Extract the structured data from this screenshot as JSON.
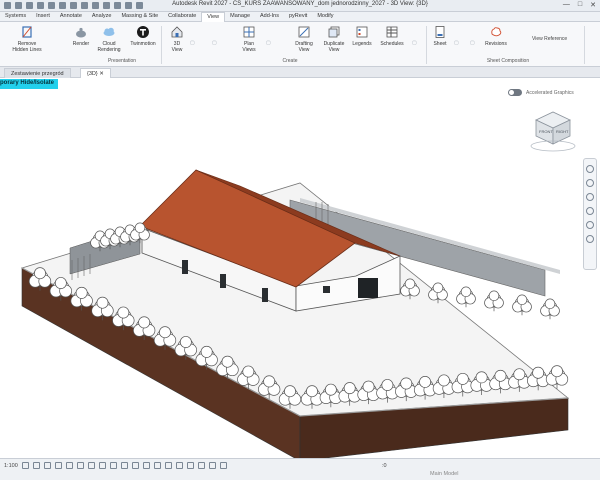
{
  "titlebar": {
    "title": "Autodesk Revit 2027 - CS_KURS ZAAWANSOWANY_dom jednorodzinny_2027 - 3D View: {3D}",
    "quick_access_icons": [
      "open-icon",
      "save-icon",
      "undo-icon",
      "redo-icon",
      "print-icon",
      "measure-icon",
      "tag-icon",
      "text-icon",
      "3d-view-icon",
      "section-icon",
      "thin-lines-icon",
      "close-hidden-icon",
      "switch-windows-icon"
    ]
  },
  "ribbon_tabs": [
    {
      "label": "Systems",
      "active": false
    },
    {
      "label": "Insert",
      "active": false
    },
    {
      "label": "Annotate",
      "active": false
    },
    {
      "label": "Analyze",
      "active": false
    },
    {
      "label": "Massing & Site",
      "active": false
    },
    {
      "label": "Collaborate",
      "active": false
    },
    {
      "label": "View",
      "active": true
    },
    {
      "label": "Manage",
      "active": false
    },
    {
      "label": "Add-Ins",
      "active": false
    },
    {
      "label": "pyRevit",
      "active": false
    },
    {
      "label": "Modify",
      "active": false
    }
  ],
  "ribbon": {
    "buttons": [
      {
        "label": "Remove\nHidden Lines",
        "icon": "remove-hidden-lines-icon",
        "disabled": false
      },
      {
        "label": "Render",
        "icon": "teapot-icon",
        "disabled": false
      },
      {
        "label": "Cloud\nRendering",
        "icon": "cloud-rendering-icon",
        "disabled": false
      },
      {
        "label": "Twinmotion",
        "icon": "twinmotion-icon",
        "disabled": false
      },
      {
        "label": "3D\nView",
        "icon": "3d-view-icon",
        "disabled": false
      },
      {
        "label": "Plan\nViews",
        "icon": "plan-views-icon",
        "disabled": false
      },
      {
        "label": "Drafting\nView",
        "icon": "drafting-view-icon",
        "disabled": false
      },
      {
        "label": "Duplicate\nView",
        "icon": "duplicate-view-icon",
        "disabled": false
      },
      {
        "label": "Legends",
        "icon": "legends-icon",
        "disabled": false
      },
      {
        "label": "Schedules",
        "icon": "schedules-icon",
        "disabled": false
      },
      {
        "label": "Sheet",
        "icon": "sheet-icon",
        "disabled": false
      },
      {
        "label": "Revisions",
        "icon": "revisions-icon",
        "disabled": false
      }
    ],
    "panels": [
      {
        "label": "Presentation"
      },
      {
        "label": "Create"
      },
      {
        "label": "Sheet Composition"
      }
    ],
    "small_commands": [
      {
        "label": "View Reference",
        "disabled": false
      }
    ]
  },
  "doc_tabs": [
    {
      "label": "Zestawienie przegród",
      "active": false
    },
    {
      "label": "{3D}",
      "active": true
    }
  ],
  "viewport": {
    "temp_banner": "porary Hide/Isolate",
    "toggle_label": "Accelerated Graphics",
    "viewcube_faces": [
      "FRONT",
      "RIGHT"
    ]
  },
  "statusbar": {
    "scale": "1:100",
    "coord": ":0",
    "model": "Main Model"
  },
  "colors": {
    "roof": "#b8542f",
    "soil": "#5a3322",
    "banner": "#22d0ec"
  }
}
